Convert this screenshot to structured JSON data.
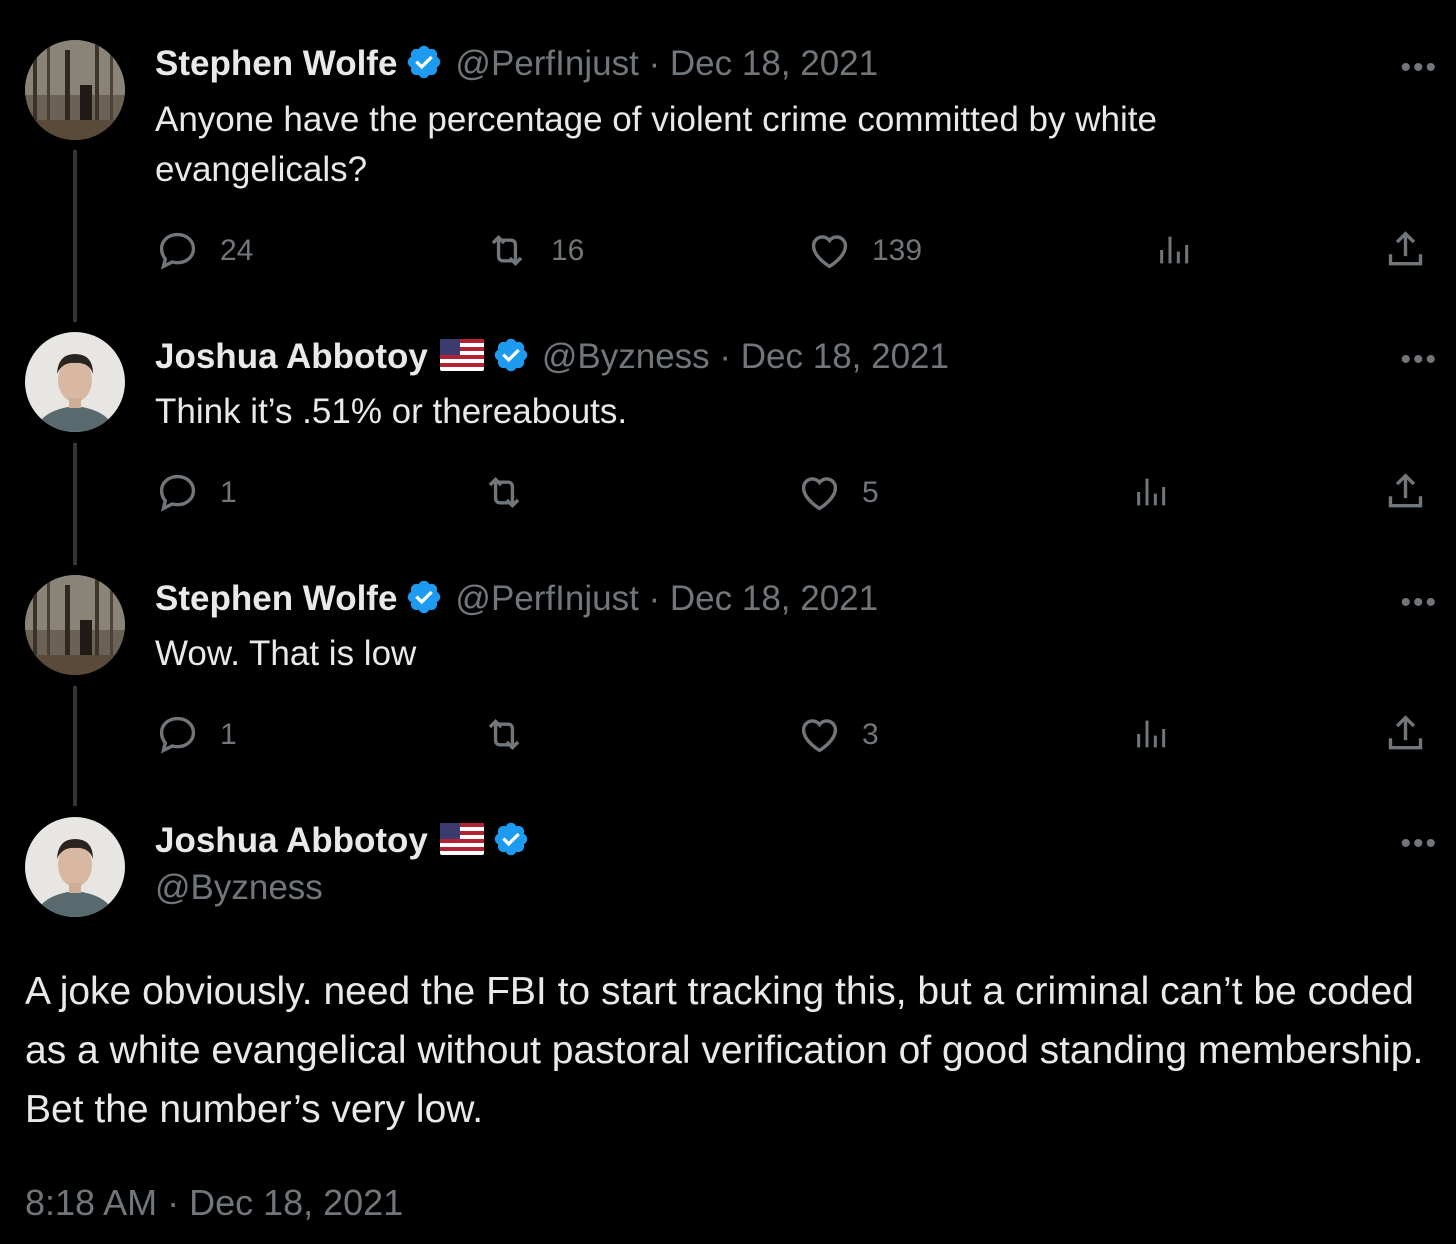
{
  "tweets": [
    {
      "name": "Stephen Wolfe",
      "handle_date": "@PerfInjust · Dec 18, 2021",
      "text": "Anyone have the percentage of violent crime committed by white evangelicals?",
      "replies": "24",
      "retweets": "16",
      "likes": "139"
    },
    {
      "name": "Joshua Abbotoy",
      "handle_date": "@Byzness · Dec 18, 2021",
      "text": "Think it’s .51% or thereabouts.",
      "replies": "1",
      "retweets": "",
      "likes": "5"
    },
    {
      "name": "Stephen Wolfe",
      "handle_date": "@PerfInjust · Dec 18, 2021",
      "text": "Wow. That is low",
      "replies": "1",
      "retweets": "",
      "likes": "3"
    }
  ],
  "main": {
    "name": "Joshua Abbotoy",
    "handle": "@Byzness",
    "text": "A joke obviously. need the FBI to start tracking this, but a criminal can’t be coded as a white evangelical without pastoral verification of good standing membership. Bet the number’s very low.",
    "timestamp": "8:18 AM · Dec 18, 2021"
  },
  "icons": {
    "more": "more-icon",
    "reply": "reply-icon",
    "retweet": "retweet-icon",
    "like": "like-icon",
    "views": "views-icon",
    "share": "share-icon",
    "verified": "verified-badge-icon",
    "flag": "us-flag-icon"
  },
  "colors": {
    "background": "#000000",
    "text": "#e7e9ea",
    "muted": "#71767b",
    "verified": "#1d9bf0"
  }
}
